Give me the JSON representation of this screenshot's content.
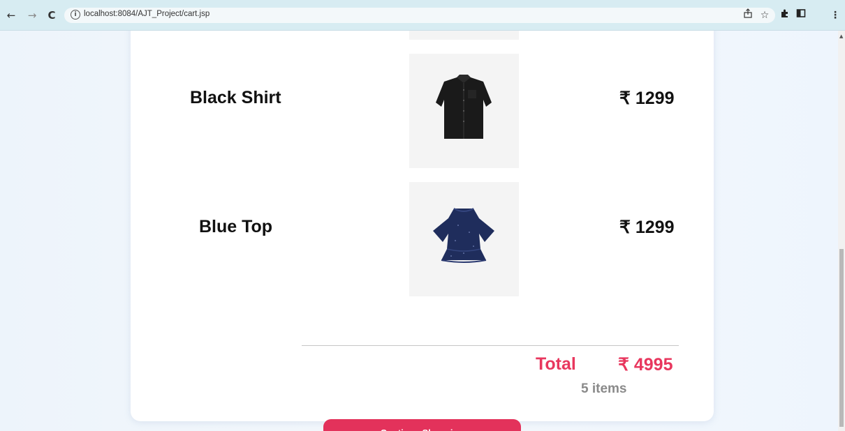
{
  "browser": {
    "url": "localhost:8084/AJT_Project/cart.jsp",
    "back_icon": "←",
    "forward_icon": "→",
    "reload_icon": "C"
  },
  "cart": {
    "items": [
      {
        "name": "Black Shirt",
        "price": "₹ 1299",
        "image": "black-shirt"
      },
      {
        "name": "Blue Top",
        "price": "₹ 1299",
        "image": "blue-top"
      }
    ],
    "total_label": "Total",
    "total_value": "₹ 4995",
    "items_count": "5 items",
    "continue_label": "Continue Shopping"
  },
  "colors": {
    "accent": "#e3325b",
    "total": "#e8375e"
  }
}
